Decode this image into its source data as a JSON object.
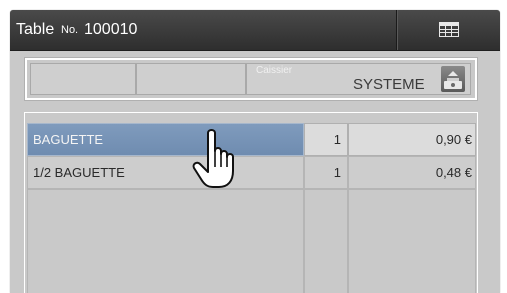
{
  "header": {
    "title_label": "Table",
    "number_prefix": "No.",
    "number": "100010",
    "grid_button_icon": "grid-icon"
  },
  "info": {
    "cashier_label": "Caissier",
    "operator_name": "SYSTEME",
    "operator_icon": "cash-register-icon"
  },
  "items": [
    {
      "name": "BAGUETTE",
      "qty": "1",
      "price": "0,90 €",
      "selected": true
    },
    {
      "name": "1/2 BAGUETTE",
      "qty": "1",
      "price": "0,48 €",
      "selected": false
    }
  ],
  "colors": {
    "titlebar": "#3a3a3a",
    "selected_row": "#7892b5",
    "panel": "#c9c9c9"
  }
}
